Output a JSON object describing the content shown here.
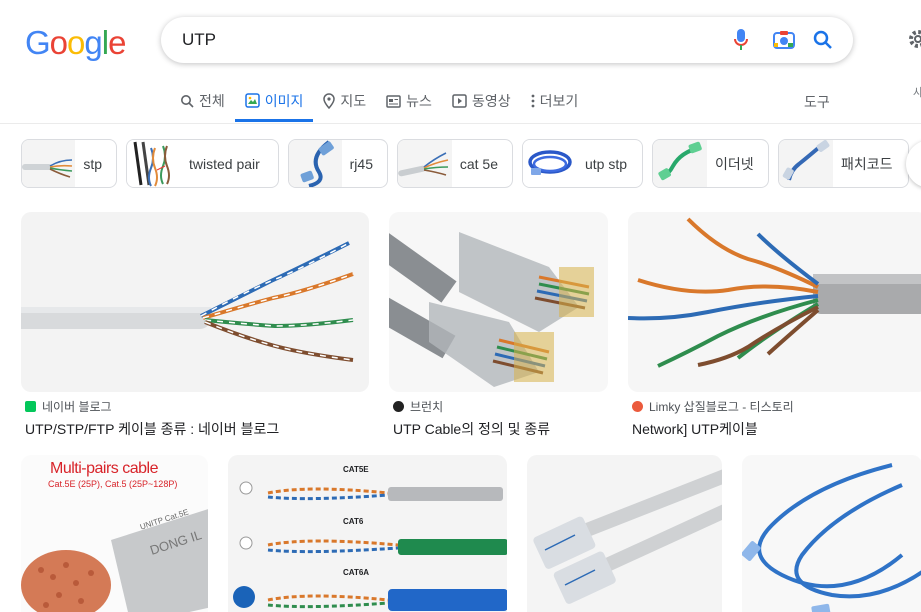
{
  "search": {
    "query": "UTP"
  },
  "tabs": [
    {
      "label": "전체"
    },
    {
      "label": "이미지"
    },
    {
      "label": "지도"
    },
    {
      "label": "뉴스"
    },
    {
      "label": "동영상"
    },
    {
      "label": "더보기"
    }
  ],
  "tools_label": "도구",
  "side_text": "사",
  "chips": [
    {
      "label": "stp"
    },
    {
      "label": "twisted pair"
    },
    {
      "label": "rj45"
    },
    {
      "label": "cat 5e"
    },
    {
      "label": "utp stp"
    },
    {
      "label": "이더넷"
    },
    {
      "label": "패치코드"
    }
  ],
  "results": [
    {
      "source": "네이버 블로그",
      "title": "UTP/STP/FTP 케이블 종류 : 네이버 블로그",
      "favicon_color": "#03c75a"
    },
    {
      "source": "브런치",
      "title": "UTP Cable의 정의 및 종류",
      "favicon_color": "#222222"
    },
    {
      "source": "Limky 삽질블로그 - 티스토리",
      "title": "Network] UTP케이블",
      "favicon_color": "#eb5a3c"
    }
  ],
  "image_texts": {
    "multipair_title": "Multi-pairs cable",
    "multipair_sub": "Cat.5E (25P), Cat.5 (25P~128P)",
    "multipair_jacket1": "UNITP Cat.5E",
    "multipair_jacket2": "DONG IL",
    "cat5e": "CAT5E",
    "cat6": "CAT6",
    "cat6a": "CAT6A"
  },
  "colors": {
    "logo_blue": "#4285f4",
    "logo_red": "#ea4335",
    "logo_yellow": "#fbbc05",
    "logo_green": "#34a853",
    "accent": "#1a73e8"
  },
  "icons": [
    "microphone-icon",
    "camera-lens-icon",
    "search-icon",
    "gear-icon"
  ]
}
